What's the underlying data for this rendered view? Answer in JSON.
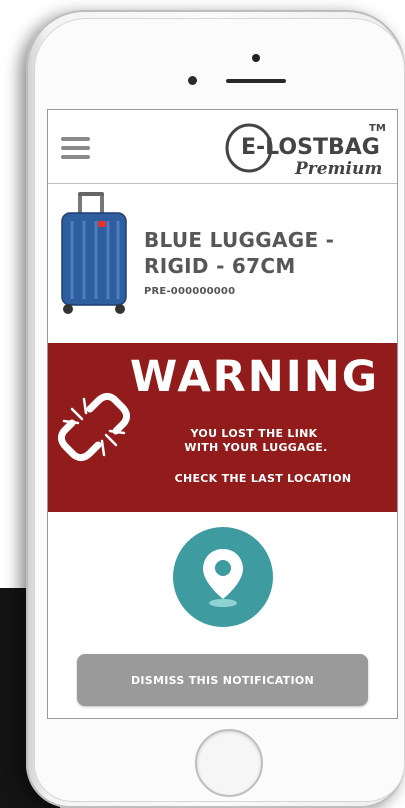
{
  "header": {
    "menu_icon": "hamburger-menu-icon",
    "logo_text": "E-LOSTBAG",
    "logo_tm": "TM",
    "logo_sub": "Premium"
  },
  "product": {
    "name_line1": "BLUE LUGGAGE -",
    "name_line2": "RIGID - 67CM",
    "id": "PRE-000000000",
    "image_icon": "blue-suitcase-image"
  },
  "warning": {
    "title": "WARNING",
    "line1": "YOU LOST THE LINK",
    "line2": "WITH YOUR LUGGAGE.",
    "line3": "CHECK THE LAST LOCATION",
    "icon": "broken-link-icon",
    "bg_color": "#921b1b"
  },
  "location": {
    "icon": "location-pin-icon",
    "color": "#3e9ba0"
  },
  "dismiss": {
    "label": "DISMISS THIS NOTIFICATION",
    "color": "#9a9a9a"
  },
  "device": {
    "home_button": "home-button"
  }
}
